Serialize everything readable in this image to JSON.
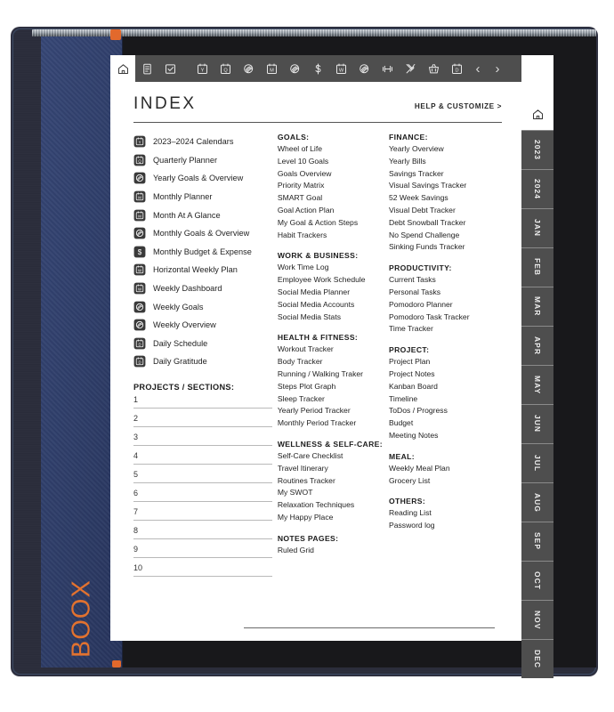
{
  "device": {
    "brand": "BOOX"
  },
  "toolbar": {
    "icons": [
      {
        "name": "home-icon",
        "glyph": "home",
        "active": true
      },
      {
        "name": "notes-icon",
        "glyph": "clipboard",
        "active": false
      },
      {
        "name": "checklist-icon",
        "glyph": "check-square",
        "active": false
      },
      {
        "name": "yearly-icon",
        "glyph": "cal-Y",
        "active": false
      },
      {
        "name": "quarterly-icon",
        "glyph": "cal-Q",
        "active": false
      },
      {
        "name": "yearly-goals-icon",
        "glyph": "swirl",
        "active": false
      },
      {
        "name": "monthly-icon",
        "glyph": "cal-M",
        "active": false
      },
      {
        "name": "monthly-goals-icon",
        "glyph": "swirl",
        "active": false
      },
      {
        "name": "budget-icon",
        "glyph": "dollar",
        "active": false
      },
      {
        "name": "weekly-icon",
        "glyph": "cal-W",
        "active": false
      },
      {
        "name": "weekly-goals-icon",
        "glyph": "swirl",
        "active": false
      },
      {
        "name": "fitness-icon",
        "glyph": "dumbbell",
        "active": false
      },
      {
        "name": "meal-icon",
        "glyph": "cutlery",
        "active": false
      },
      {
        "name": "grocery-icon",
        "glyph": "basket",
        "active": false
      },
      {
        "name": "daily-icon",
        "glyph": "cal-D",
        "active": false
      }
    ],
    "prev_label": "‹",
    "next_label": "›"
  },
  "header": {
    "title": "INDEX",
    "help_label": "HELP & CUSTOMIZE >"
  },
  "left_column": {
    "items": [
      {
        "icon": "cal-Y",
        "label": "2023–2024 Calendars"
      },
      {
        "icon": "cal-Q",
        "label": "Quarterly Planner"
      },
      {
        "icon": "swirl",
        "label": "Yearly Goals & Overview"
      },
      {
        "icon": "cal-M",
        "label": "Monthly Planner"
      },
      {
        "icon": "cal-M",
        "label": "Month At A Glance"
      },
      {
        "icon": "swirl",
        "label": "Monthly Goals & Overview"
      },
      {
        "icon": "dollar",
        "label": "Monthly Budget & Expense"
      },
      {
        "icon": "cal-W",
        "label": "Horizontal Weekly Plan"
      },
      {
        "icon": "cal-W",
        "label": "Weekly Dashboard"
      },
      {
        "icon": "swirl",
        "label": "Weekly Goals"
      },
      {
        "icon": "swirl",
        "label": "Weekly Overview"
      },
      {
        "icon": "cal-D",
        "label": "Daily Schedule"
      },
      {
        "icon": "cal-D",
        "label": "Daily Gratitude"
      }
    ],
    "projects_heading": "PROJECTS / SECTIONS:",
    "project_numbers": [
      "1",
      "2",
      "3",
      "4",
      "5",
      "6",
      "7",
      "8",
      "9",
      "10"
    ]
  },
  "middle_column": [
    {
      "heading": "GOALS:",
      "items": [
        "Wheel of Life",
        "Level 10 Goals",
        "Goals Overview",
        "Priority Matrix",
        "SMART Goal",
        "Goal Action Plan",
        "My Goal & Action Steps",
        "Habit Trackers"
      ]
    },
    {
      "heading": "WORK & BUSINESS:",
      "items": [
        "Work Time Log",
        "Employee Work Schedule",
        "Social Media Planner",
        "Social Media Accounts",
        "Social Media Stats"
      ]
    },
    {
      "heading": "HEALTH & FITNESS:",
      "items": [
        "Workout Tracker",
        "Body Tracker",
        "Running / Walking Traker",
        "Steps Plot Graph",
        "Sleep Tracker",
        "Yearly Period Tracker",
        "Monthly Period Tracker"
      ]
    },
    {
      "heading": "WELLNESS & SELF-CARE:",
      "items": [
        "Self-Care Checklist",
        "Travel Itinerary",
        "Routines Tracker",
        "My SWOT",
        "Relaxation Techniques",
        "My Happy Place"
      ]
    },
    {
      "heading": "NOTES PAGES:",
      "items": [
        "Ruled Grid"
      ]
    }
  ],
  "right_column": [
    {
      "heading": "FINANCE:",
      "items": [
        "Yearly Overview",
        "Yearly Bills",
        "Savings Tracker",
        "Visual Savings Tracker",
        "52 Week Savings",
        "Visual Debt Tracker",
        "Debt Snowball Tracker",
        "No Spend Challenge",
        "Sinking Funds Tracker"
      ]
    },
    {
      "heading": "PRODUCTIVITY:",
      "items": [
        "Current Tasks",
        "Personal Tasks",
        "Pomodoro Planner",
        "Pomodoro Task Tracker",
        "Time Tracker"
      ]
    },
    {
      "heading": "PROJECT:",
      "items": [
        "Project Plan",
        "Project Notes",
        "Kanban Board",
        "Timeline",
        "ToDos / Progress",
        "Budget",
        "Meeting Notes"
      ]
    },
    {
      "heading": "MEAL:",
      "items": [
        "Weekly Meal Plan",
        "Grocery List"
      ]
    },
    {
      "heading": "OTHERS:",
      "items": [
        "Reading List",
        "Password log"
      ]
    }
  ],
  "side_rail": {
    "home_icon": "home-icon",
    "tabs": [
      "2023",
      "2024",
      "JAN",
      "FEB",
      "MAR",
      "APR",
      "MAY",
      "JUN",
      "JUL",
      "AUG",
      "SEP",
      "OCT",
      "NOV",
      "DEC"
    ]
  },
  "colors": {
    "cover": "#2f3f6b",
    "brand_orange": "#e2722f",
    "toolbar": "#4e4e4e",
    "frame": "#2b2d3b",
    "page": "#ffffff"
  }
}
